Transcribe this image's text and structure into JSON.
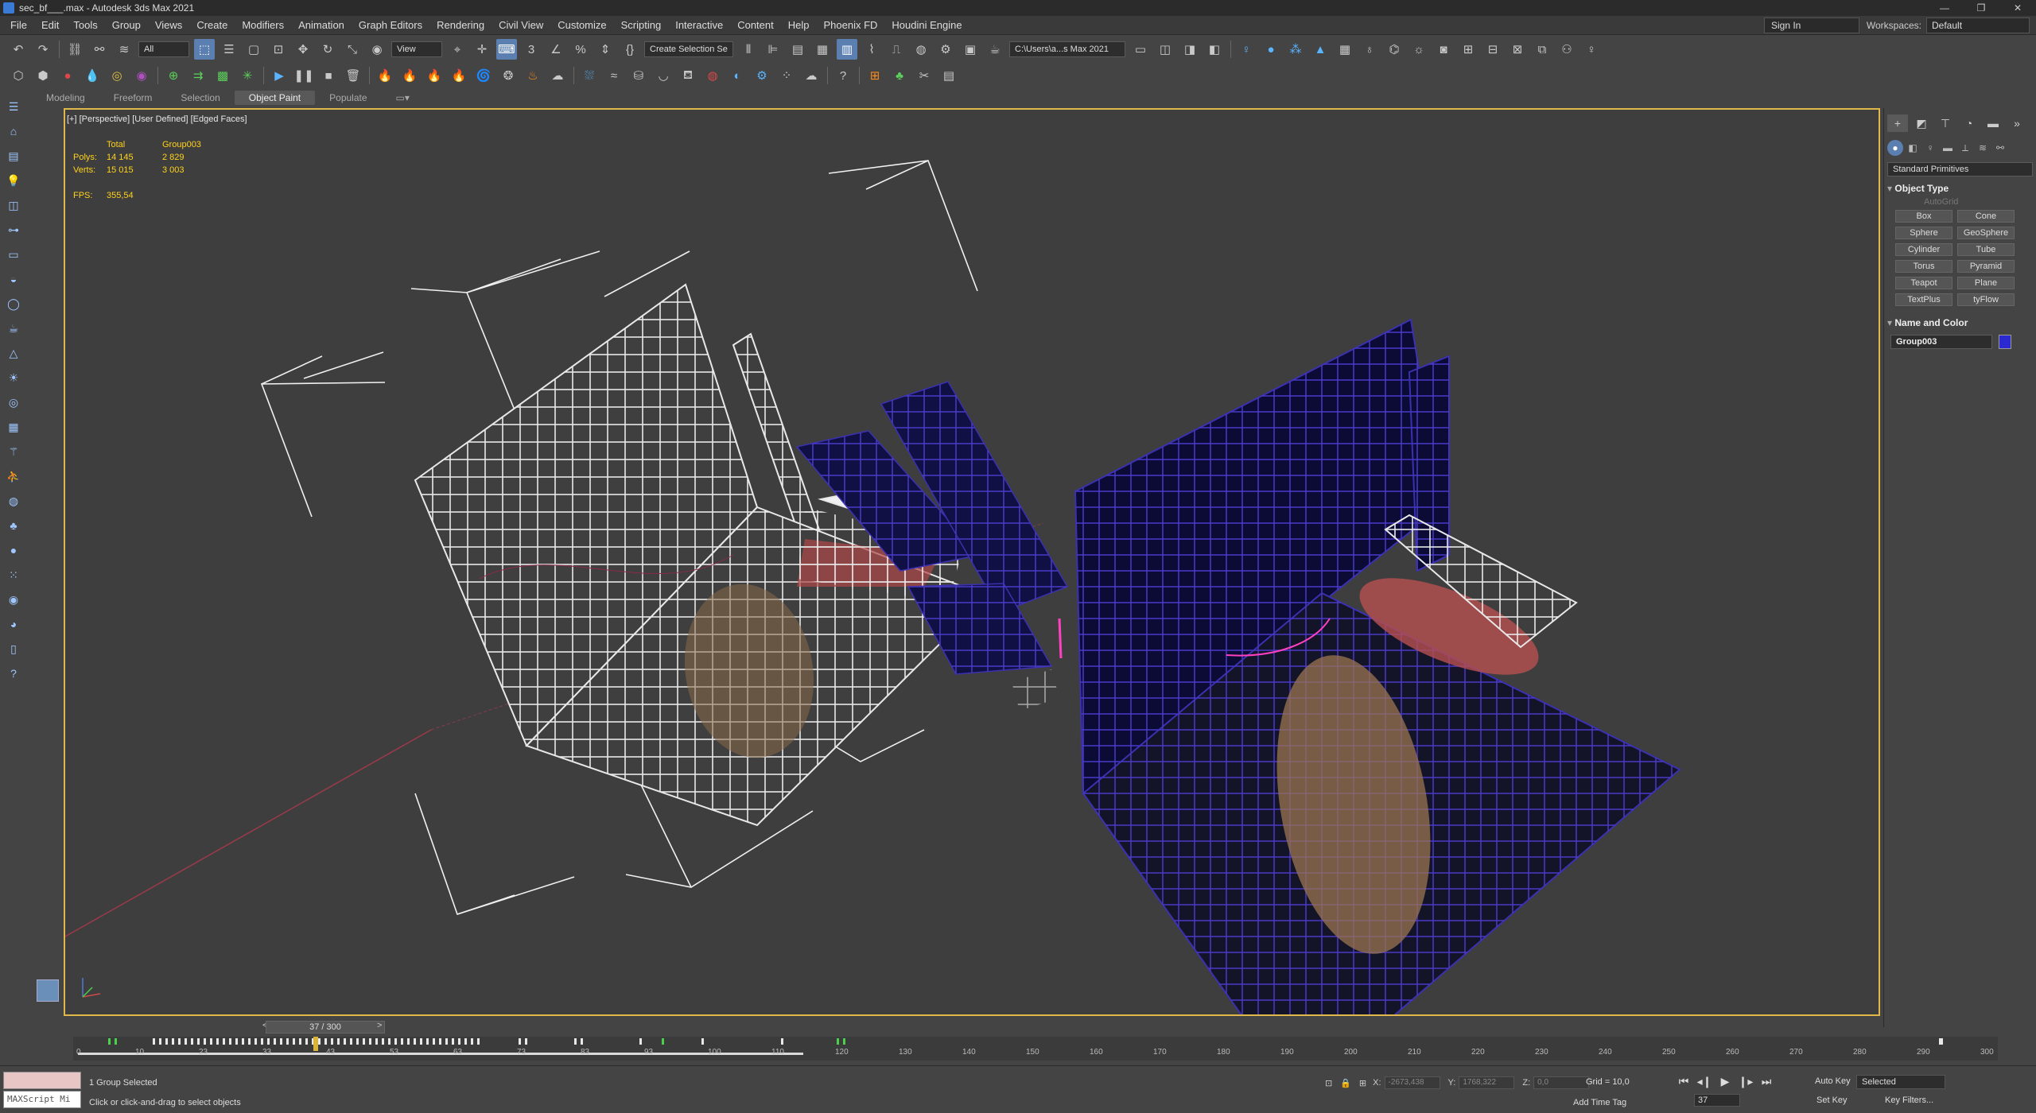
{
  "window": {
    "title": "sec_bf___.max - Autodesk 3ds Max 2021",
    "controls": [
      "—",
      "❐",
      "✕"
    ]
  },
  "menu": [
    "File",
    "Edit",
    "Tools",
    "Group",
    "Views",
    "Create",
    "Modifiers",
    "Animation",
    "Graph Editors",
    "Rendering",
    "Civil View",
    "Customize",
    "Scripting",
    "Interactive",
    "Content",
    "Help",
    "Phoenix FD",
    "Houdini Engine"
  ],
  "account": {
    "signin": "Sign In",
    "workspaces_label": "Workspaces:",
    "workspace_value": "Default"
  },
  "toolbar": {
    "selection_filter": "All",
    "ref_coord": "View",
    "named_selection": "Create Selection Se",
    "project_path": "C:\\Users\\a...s Max 2021"
  },
  "ribbon": {
    "tabs": [
      "Modeling",
      "Freeform",
      "Selection",
      "Object Paint",
      "Populate"
    ],
    "active": "Object Paint"
  },
  "viewport": {
    "label": "[+] [Perspective] [User Defined] [Edged Faces]",
    "stats": {
      "header": [
        "",
        "Total",
        "Group003"
      ],
      "polys": [
        "Polys:",
        "14 145",
        "2 829"
      ],
      "verts": [
        "Verts:",
        "15 015",
        "3 003"
      ],
      "fps": [
        "FPS:",
        "355,54"
      ]
    }
  },
  "command_panel": {
    "dropdown": "Standard Primitives",
    "object_type_title": "Object Type",
    "autogrid": "AutoGrid",
    "buttons": [
      "Box",
      "Cone",
      "Sphere",
      "GeoSphere",
      "Cylinder",
      "Tube",
      "Torus",
      "Pyramid",
      "Teapot",
      "Plane",
      "TextPlus",
      "tyFlow"
    ],
    "name_color_title": "Name and Color",
    "name_value": "Group003",
    "color": "#2a2ad0"
  },
  "timeline": {
    "frame_display": "37 / 300",
    "prev": "<",
    "next": ">",
    "ticks": [
      "0",
      "10",
      "23",
      "33",
      "43",
      "53",
      "63",
      "73",
      "83",
      "93",
      "100",
      "110",
      "120",
      "130",
      "140",
      "150",
      "160",
      "170",
      "180",
      "190",
      "200",
      "210",
      "220",
      "230",
      "240",
      "250",
      "260",
      "270",
      "280",
      "290",
      "300"
    ]
  },
  "status": {
    "selection": "1 Group Selected",
    "prompt": "Click or click-and-drag to select objects",
    "maxscript": "MAXScript Mi",
    "x_label": "X:",
    "x_value": "-2673,438",
    "y_label": "Y:",
    "y_value": "1768,322",
    "z_label": "Z:",
    "z_value": "0,0",
    "grid": "Grid = 10,0",
    "add_time_tag": "Add Time Tag",
    "current_frame": "37",
    "auto_key": "Auto Key",
    "set_key": "Set Key",
    "selected_filter": "Selected",
    "key_filters": "Key Filters..."
  }
}
